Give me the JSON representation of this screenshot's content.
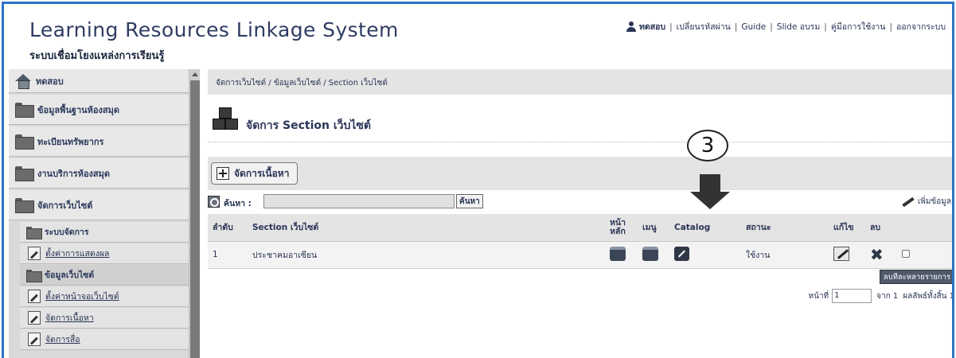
{
  "header": {
    "title": "Learning Resources Linkage System",
    "subtitle": "ระบบเชื่อมโยงแหล่งการเรียนรู้",
    "nav": [
      "ทดสอบ",
      "เปลี่ยนรหัสผ่าน",
      "Guide",
      "Slide อบรม",
      "คู่มือการใช้งาน",
      "ออกจากระบบ"
    ],
    "separator": "|"
  },
  "sidebar": {
    "home_label": "ทดสอบ",
    "items": [
      "ข้อมูลพื้นฐานห้องสมุด",
      "ทะเบียนทรัพยากร",
      "งานบริการห้องสมุด",
      "จัดการเว็บไซต์"
    ],
    "subitems": [
      {
        "label": "ระบบจัดการ",
        "kind": "folder"
      },
      {
        "label": "ตั้งค่าการแสดงผล",
        "kind": "link"
      },
      {
        "label": "ข้อมูลเว็บไซต์",
        "kind": "folder"
      },
      {
        "label": "ตั้งค่าหน้าจอเว็บไซต์",
        "kind": "link"
      },
      {
        "label": "จัดการเนื้อหา",
        "kind": "link"
      },
      {
        "label": "จัดการสื่อ",
        "kind": "link"
      }
    ]
  },
  "breadcrumb": "จัดการเว็บไซต์ / ข้อมูลเว็บไซต์ / Section เว็บไซต์",
  "page_title": "จัดการ Section เว็บไซต์",
  "annotation_step": "3",
  "toolbar": {
    "manage_content_label": "จัดการเนื้อหา"
  },
  "search": {
    "label": "ค้นหา :",
    "button_label": "ค้นหา",
    "value": ""
  },
  "add_data_label": "เพิ่มข้อมูล",
  "table": {
    "headers": {
      "order": "ลำดับ",
      "section": "Section เว็บไซต์",
      "main_page": "หน้า\nหลัก",
      "menu": "เมนู",
      "catalog": "Catalog",
      "status": "สถานะ",
      "edit": "แก้ไข",
      "delete": "ลบ"
    },
    "rows": [
      {
        "order": "1",
        "section": "ประชาคมอาเซียน",
        "status": "ใช้งาน"
      }
    ]
  },
  "multi_delete_label": "ลบทีละหลายรายการ",
  "pager": {
    "page_label": "หน้าที่",
    "page_value": "1",
    "of_label": "จาก 1",
    "total_label": "ผลลัพธ์ทั้งสิ้น 1"
  }
}
